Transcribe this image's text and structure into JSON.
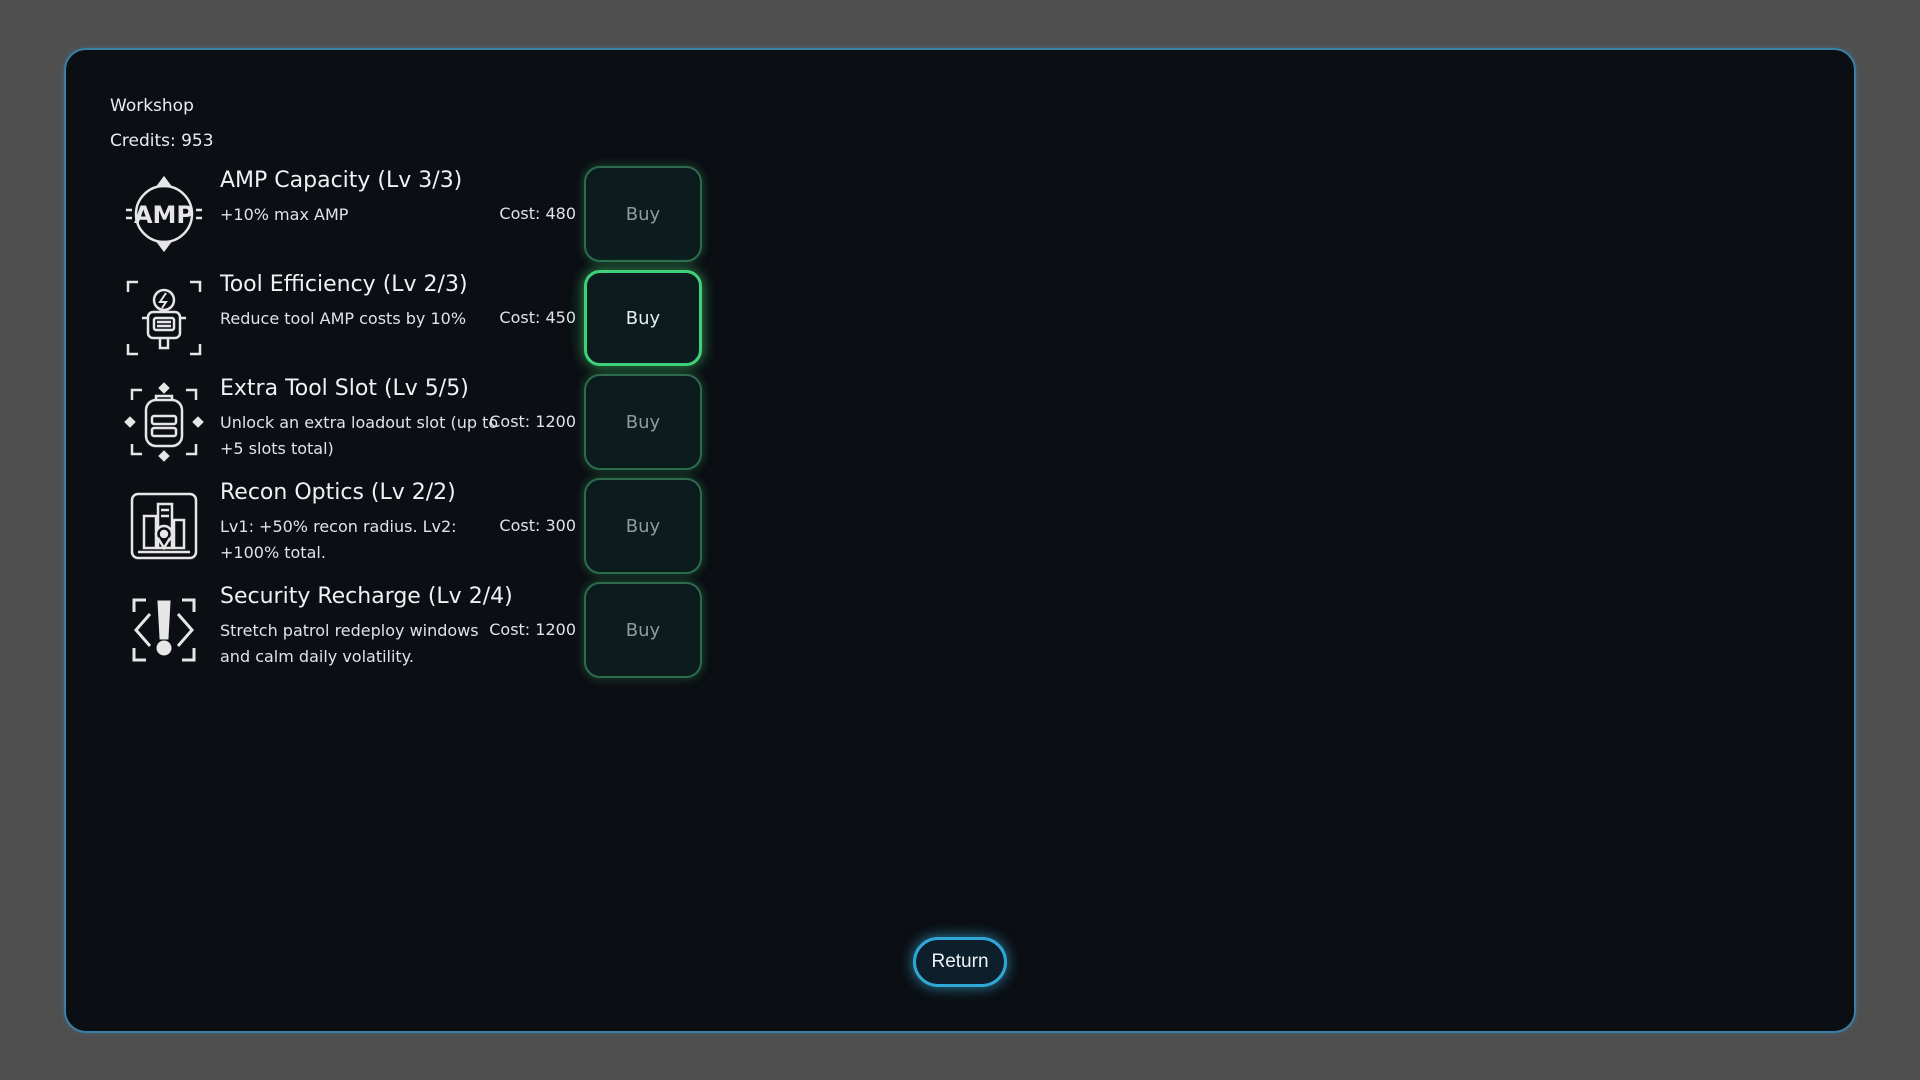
{
  "window": {
    "title": "Workshop",
    "credits": "Credits: 953"
  },
  "upgrades": [
    {
      "name": "AMP Capacity (Lv 3/3)",
      "description": "+10% max AMP",
      "cost": "Cost: 480",
      "button": "Buy",
      "icon": "amp-badge-icon",
      "active": false
    },
    {
      "name": "Tool Efficiency (Lv 2/3)",
      "description": "Reduce tool AMP costs by 10%",
      "cost": "Cost: 450",
      "button": "Buy",
      "icon": "tool-lightning-icon",
      "active": true
    },
    {
      "name": "Extra Tool Slot (Lv 5/5)",
      "description": "Unlock an extra loadout slot (up to +5 slots total)",
      "cost": "Cost: 1200",
      "button": "Buy",
      "icon": "backpack-icon",
      "active": false
    },
    {
      "name": "Recon Optics (Lv 2/2)",
      "description": "Lv1: +50% recon radius. Lv2: +100% total.",
      "cost": "Cost: 300",
      "button": "Buy",
      "icon": "city-map-pin-icon",
      "active": false
    },
    {
      "name": "Security Recharge (Lv 2/4)",
      "description": "Stretch patrol redeploy windows and calm daily volatility.",
      "cost": "Cost: 1200",
      "button": "Buy",
      "icon": "alert-brackets-icon",
      "active": false
    }
  ],
  "footer": {
    "return_label": "Return"
  },
  "colors": {
    "background": "#4f4f4f",
    "panel": "#0b0e13",
    "panel_border": "#3a7fa6",
    "buy_glow": "#3fd07a",
    "return_glow": "#2fa8d8"
  }
}
